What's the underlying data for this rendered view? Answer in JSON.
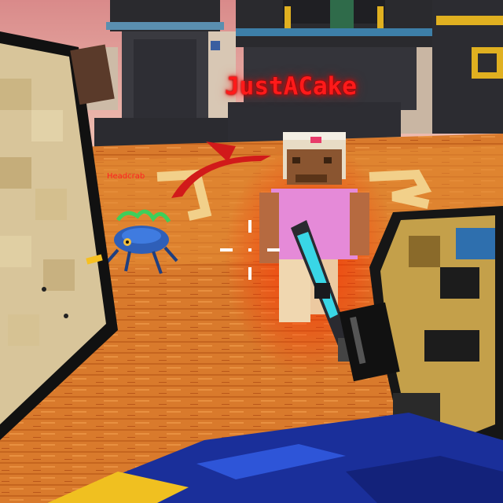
{
  "hud": {
    "target_player_name": "JustACake",
    "enemy_label": "Headcrab"
  },
  "colors": {
    "player_name_color": "#ff1a1a",
    "enemy_label_color": "#ff2222",
    "floor_color": "#d9772a",
    "sky_color": "#e8a2a0",
    "damage_indicator_color": "#d11a1a",
    "crosshair_color": "#ffffff"
  },
  "icons": {
    "crosshair": "crosshair-icon",
    "damage_direction": "damage-direction-arc-icon"
  }
}
